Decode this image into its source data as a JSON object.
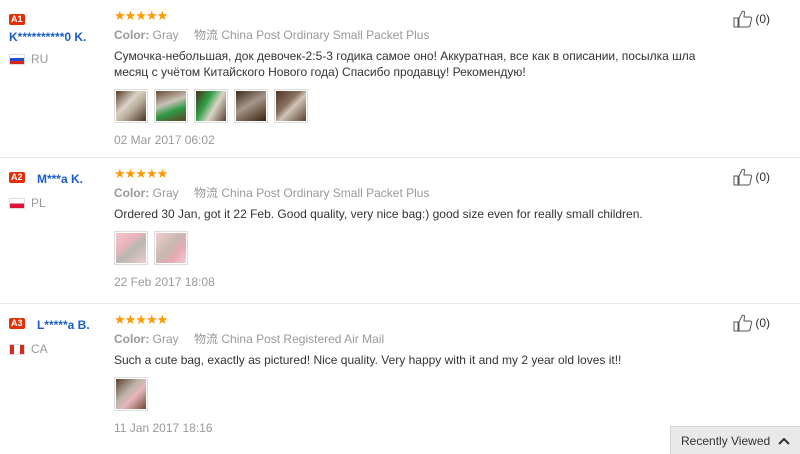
{
  "reviews": [
    {
      "rank": "A1",
      "name": "K**********0 K.",
      "country": "RU",
      "stars": "★★★★★",
      "color_label": "Color:",
      "color_value": "Gray",
      "shipping_icon": "物流",
      "shipping": "China Post Ordinary Small Packet Plus",
      "text": "Сумочка-небольшая, док девочек-2:5-3 годика самое оно! Аккуратная, все как в описании, посылка шла месяц с учётом Китайского Нового года) Спасибо продавцу! Рекомендую!",
      "photo_count": 5,
      "date": "02 Mar 2017 06:02",
      "likes": "(0)"
    },
    {
      "rank": "A2",
      "name": "M***a K.",
      "country": "PL",
      "stars": "★★★★★",
      "color_label": "Color:",
      "color_value": "Gray",
      "shipping_icon": "物流",
      "shipping": "China Post Ordinary Small Packet Plus",
      "text": "Ordered 30 Jan, got it 22 Feb. Good quality, very nice bag:) good size even for really small children.",
      "photo_count": 2,
      "date": "22 Feb 2017 18:08",
      "likes": "(0)"
    },
    {
      "rank": "A3",
      "name": "L*****a B.",
      "country": "CA",
      "stars": "★★★★★",
      "color_label": "Color:",
      "color_value": "Gray",
      "shipping_icon": "物流",
      "shipping": "China Post Registered Air Mail",
      "text": "Such a cute bag, exactly as pictured! Nice quality. Very happy with it and my 2 year old loves it!!",
      "photo_count": 1,
      "date": "11 Jan 2017 18:16",
      "likes": "(0)"
    }
  ],
  "recently_viewed": {
    "label": "Recently Viewed",
    "icon": "chevron-up-icon"
  },
  "colors": {
    "rank_badge": "#e62e04",
    "user_link": "#1a5dc8",
    "stars": "#ff9900",
    "muted": "#999999"
  }
}
